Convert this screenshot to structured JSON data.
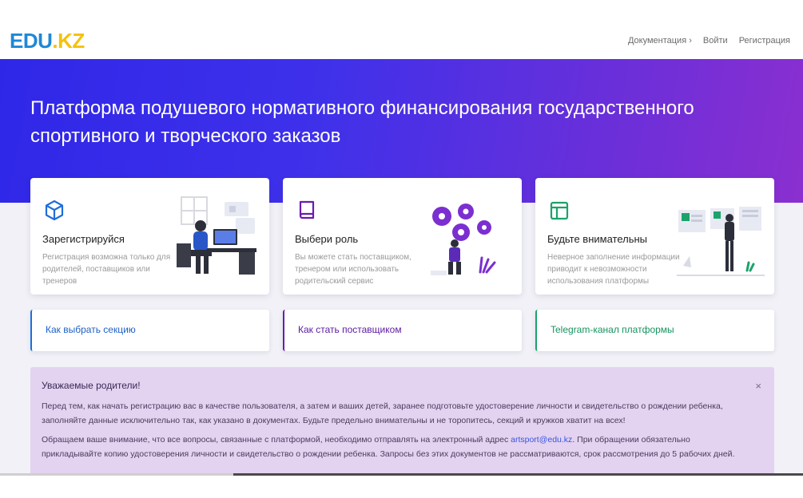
{
  "logo": {
    "part1": "EDU",
    "part2": ".KZ"
  },
  "nav": {
    "docs": "Документация ›",
    "login": "Войти",
    "register": "Регистрация"
  },
  "hero": {
    "title": "Платформа подушевого нормативного финансирования государственного спортивного и творческого заказов"
  },
  "cards": [
    {
      "title": "Зарегистрируйся",
      "desc": "Регистрация возможна только для родителей, поставщиков или тренеров",
      "icon": "cube-icon",
      "color": "#1e6fd9"
    },
    {
      "title": "Выбери роль",
      "desc": "Вы можете стать поставщиком, тренером или использовать родительский сервис",
      "icon": "book-icon",
      "color": "#6a1bb0"
    },
    {
      "title": "Будьте внимательны",
      "desc": "Неверное заполнение информации приводит к невозможности использования платформы",
      "icon": "layout-icon",
      "color": "#1aa36a"
    }
  ],
  "links": [
    {
      "label": "Как выбрать секцию",
      "color": "#1e6fd9"
    },
    {
      "label": "Как стать поставщиком",
      "color": "#6a1bb0"
    },
    {
      "label": "Telegram-канал платформы",
      "color": "#1aa36a"
    }
  ],
  "alert": {
    "title": "Уважаемые родители!",
    "close": "×",
    "p1": "Перед тем, как начать регистрацию вас в качестве пользователя, а затем и ваших детей, заранее подготовьте удостоверение личности и свидетельство о рождении ребенка, заполняйте данные исключительно так, как указано в документах. Будьте предельно внимательны и не торопитесь, секций и кружков хватит на всех!",
    "p2_before": "Обращаем ваше внимание, что все вопросы, связанные с платформой, необходимо отправлять на электронный адрес ",
    "email": "artsport@edu.kz",
    "p2_after": ". При обращении обязательно прикладывайте копию удостоверения личности и свидетельство о рождении ребенка. Запросы без этих документов не рассматриваются, срок рассмотрения до 5 рабочих дней."
  }
}
